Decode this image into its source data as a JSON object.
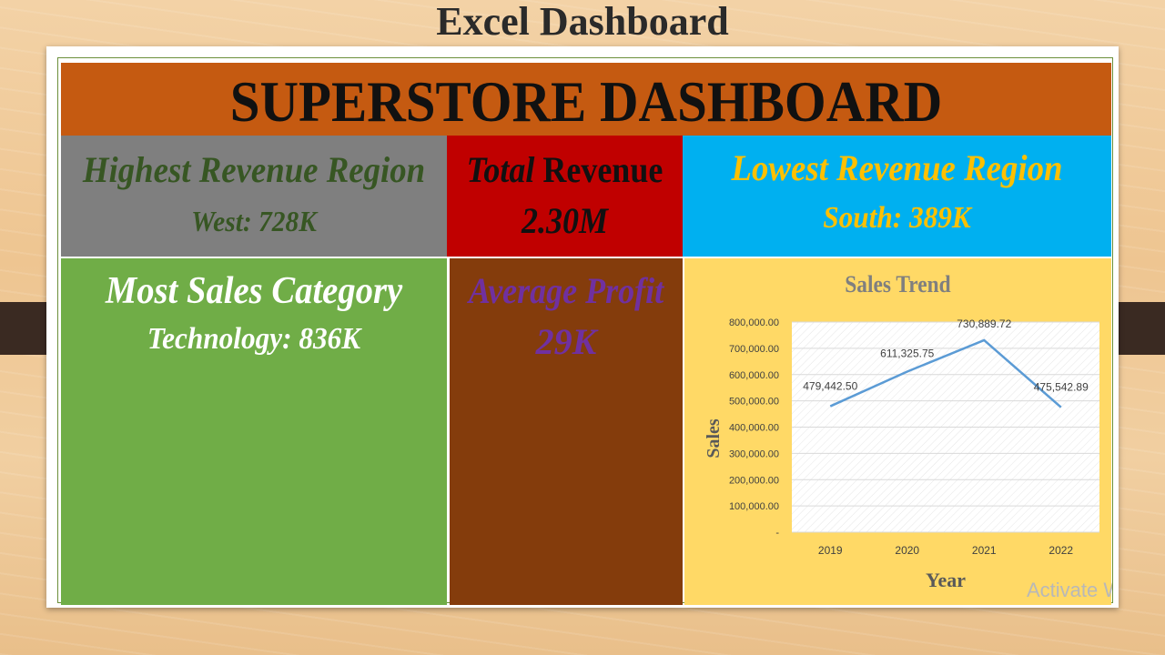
{
  "slide_title": "Excel Dashboard",
  "dashboard_title": "SUPERSTORE DASHBOARD",
  "highest_region": {
    "heading": "Highest Revenue Region",
    "value": "West: 728K"
  },
  "total_revenue": {
    "heading_italic": "Total",
    "heading_rest": " Revenue",
    "value": "2.30M"
  },
  "lowest_region": {
    "heading": "Lowest Revenue Region",
    "value": "South: 389K"
  },
  "most_sales": {
    "heading": "Most Sales Category",
    "value": "Technology: 836K"
  },
  "avg_profit": {
    "heading": "Average Profit",
    "value": "29K"
  },
  "watermark": "Activate W",
  "colors": {
    "banner": "#c55a11",
    "gray": "#7f7f7f",
    "red": "#c00000",
    "blue": "#00b0f0",
    "green": "#70ad47",
    "brown": "#843c0c",
    "yellow": "#ffd966",
    "dark_green_text": "#375623",
    "gold_text": "#ffc000",
    "purple_text": "#7030a0",
    "line": "#5b9bd5"
  },
  "chart_data": {
    "type": "line",
    "title": "Sales Trend",
    "xlabel": "Year",
    "ylabel": "Sales",
    "categories": [
      "2019",
      "2020",
      "2021",
      "2022"
    ],
    "series": [
      {
        "values": [
          479442.5,
          611325.75,
          730889.72,
          475542.89
        ]
      }
    ],
    "data_labels": [
      "479,442.50",
      "611,325.75",
      "730,889.72",
      "475,542.89"
    ],
    "y_ticks": [
      "-",
      "100,000.00",
      "200,000.00",
      "300,000.00",
      "400,000.00",
      "500,000.00",
      "600,000.00",
      "700,000.00",
      "800,000.00"
    ],
    "ylim": [
      0,
      800000
    ],
    "grid": true,
    "legend": "none"
  }
}
